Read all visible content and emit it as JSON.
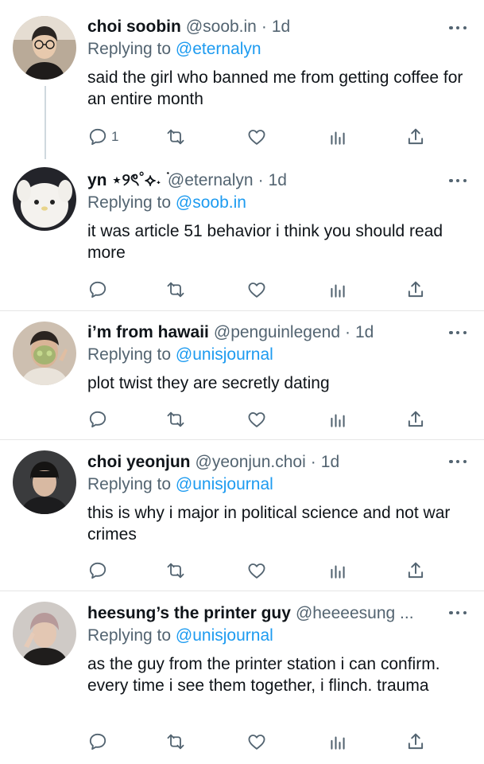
{
  "colors": {
    "text": "#0f1419",
    "secondary": "#536471",
    "link": "#1d9bf0",
    "separator": "#e6e6e6",
    "thread_line": "#cfd9de"
  },
  "icons": [
    "reply-icon",
    "retweet-icon",
    "like-icon",
    "views-icon",
    "share-icon",
    "more-icon"
  ],
  "replying_prefix": "Replying to",
  "tweets": [
    {
      "name": "choi soobin",
      "handle": "@soob.in",
      "dot": "·",
      "time": "1d",
      "reply_to": "@eternalyn",
      "text": "said the girl who banned me from getting coffee for an entire month",
      "reply_count": "1"
    },
    {
      "name": "yn ⋆୨ৎ˚⟡˖ ࣪",
      "handle": "@eternalyn",
      "dot": "·",
      "time": "1d",
      "reply_to": "@soob.in",
      "text": "it was article 51 behavior i think you should read more",
      "reply_count": ""
    },
    {
      "name": "i’m from hawaii",
      "handle": "@penguinlegend",
      "dot": "·",
      "time": "1d",
      "reply_to": "@unisjournal",
      "text": "plot twist they are secretly dating",
      "reply_count": ""
    },
    {
      "name": "choi yeonjun",
      "handle": "@yeonjun.choi",
      "dot": "·",
      "time": "1d",
      "reply_to": "@unisjournal",
      "text": "this is why i major in political science and not war crimes",
      "reply_count": ""
    },
    {
      "name": "heesung’s the printer guy",
      "handle": "@heeeesung ...",
      "dot": "",
      "time": "",
      "reply_to": "@unisjournal",
      "text": "as the guy from the printer station i can confirm. every time i see them together, i flinch. trauma",
      "reply_count": ""
    }
  ]
}
